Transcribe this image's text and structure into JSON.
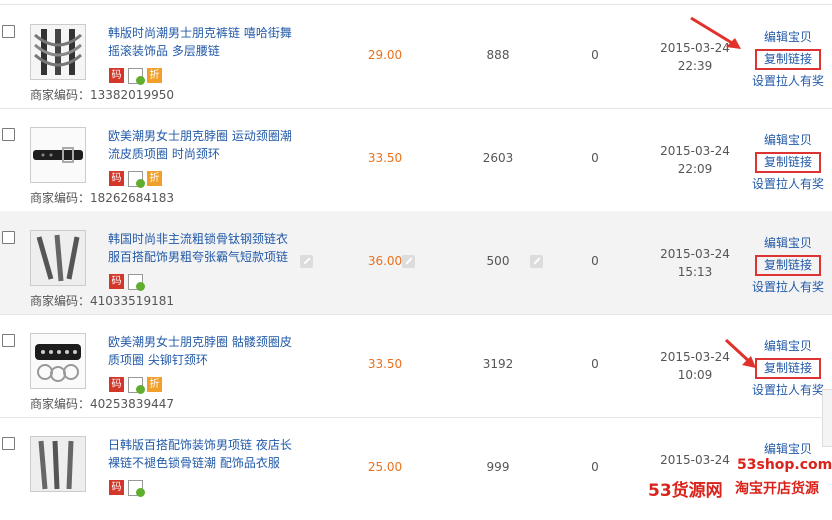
{
  "rows": [
    {
      "title": "韩版时尚潮男士朋克裤链 嘻哈街舞摇滚装饰品 多层腰链",
      "badges": [
        "码",
        "折"
      ],
      "sku": "商家编码：13382019950",
      "price": "29.00",
      "stock": "888",
      "sold": "0",
      "date": "2015-03-24",
      "time": "22:39",
      "actions": {
        "edit": "编辑宝贝",
        "copy": "复制链接",
        "reward": "设置拉人有奖"
      }
    },
    {
      "title": "欧美潮男女士朋克脖圈 运动颈圈潮流皮质项圈 时尚颈环",
      "badges": [
        "码",
        "折"
      ],
      "sku": "商家编码：18262684183",
      "price": "33.50",
      "stock": "2603",
      "sold": "0",
      "date": "2015-03-24",
      "time": "22:09",
      "actions": {
        "edit": "编辑宝贝",
        "copy": "复制链接",
        "reward": "设置拉人有奖"
      }
    },
    {
      "title": "韩国时尚非主流粗锁骨钛钢颈链衣服百搭配饰男粗夸张霸气短款项链",
      "badges": [
        "码"
      ],
      "sku": "商家编码：41033519181",
      "price": "36.00",
      "stock": "500",
      "sold": "0",
      "date": "2015-03-24",
      "time": "15:13",
      "actions": {
        "edit": "编辑宝贝",
        "copy": "复制链接",
        "reward": "设置拉人有奖"
      }
    },
    {
      "title": "欧美潮男女士朋克脖圈 骷髅颈圈皮质项圈 尖铆钉颈环",
      "badges": [
        "码",
        "折"
      ],
      "sku": "商家编码：40253839447",
      "price": "33.50",
      "stock": "3192",
      "sold": "0",
      "date": "2015-03-24",
      "time": "10:09",
      "actions": {
        "edit": "编辑宝贝",
        "copy": "复制链接",
        "reward": "设置拉人有奖"
      }
    },
    {
      "title": "日韩版百搭配饰装饰男项链 夜店长裸链不褪色锁骨链潮 配饰品衣服",
      "badges": [
        "码"
      ],
      "sku": "",
      "price": "25.00",
      "stock": "999",
      "sold": "0",
      "date": "2015-03-24",
      "time": "",
      "actions": {
        "edit": "编辑宝贝",
        "copy": "",
        "reward": ""
      }
    }
  ],
  "watermark": {
    "url": "53shop.com",
    "brand": "53货源网",
    "slogan": "淘宝开店货源"
  },
  "colors": {
    "link": "#225aa8",
    "price": "#e8711e",
    "highlight": "#d33333"
  },
  "icons": [
    "checkbox",
    "code-badge-icon",
    "verified-doc-icon",
    "discount-badge-icon",
    "edit-pencil-icon",
    "annotation-arrow-icon"
  ]
}
